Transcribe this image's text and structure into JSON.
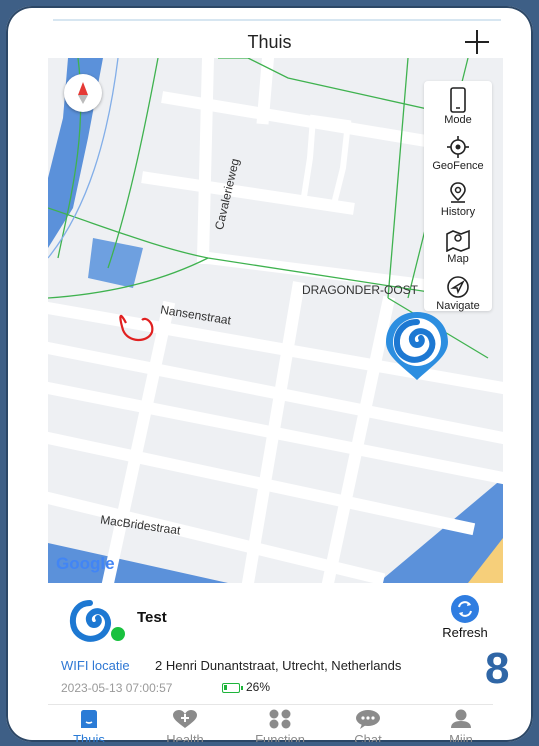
{
  "header": {
    "title": "Thuis"
  },
  "map": {
    "labels": {
      "cavalerieweg": "Cavalerieweg",
      "nansenstraat": "Nansenstraat",
      "dragonder": "DRAGONDER-OOST",
      "macbride": "MacBridestraat"
    },
    "logo": "Google",
    "tools": [
      {
        "label": "Mode",
        "icon": "phone-icon"
      },
      {
        "label": "GeoFence",
        "icon": "target-icon"
      },
      {
        "label": "History",
        "icon": "location-history-icon"
      },
      {
        "label": "Map",
        "icon": "map-icon"
      },
      {
        "label": "Navigate",
        "icon": "navigate-icon"
      }
    ]
  },
  "device": {
    "name": "Test",
    "refresh_label": "Refresh",
    "location_type": "WIFI locatie",
    "address": "2 Henri Dunantstraat, Utrecht, Netherlands",
    "timestamp": "2023-05-13 07:00:57",
    "battery": "26%",
    "battery_level": 0.26,
    "badge": "8"
  },
  "tabs": [
    {
      "label": "Thuis",
      "icon": "home-icon",
      "active": true
    },
    {
      "label": "Health",
      "icon": "health-icon",
      "active": false
    },
    {
      "label": "Function",
      "icon": "function-icon",
      "active": false
    },
    {
      "label": "Chat",
      "icon": "chat-icon",
      "active": false
    },
    {
      "label": "Mijn",
      "icon": "profile-icon",
      "active": false
    }
  ],
  "colors": {
    "accent": "#2a7bd6",
    "online": "#19c13f",
    "battery": "#1db43a",
    "road_green": "#3fb24f"
  }
}
